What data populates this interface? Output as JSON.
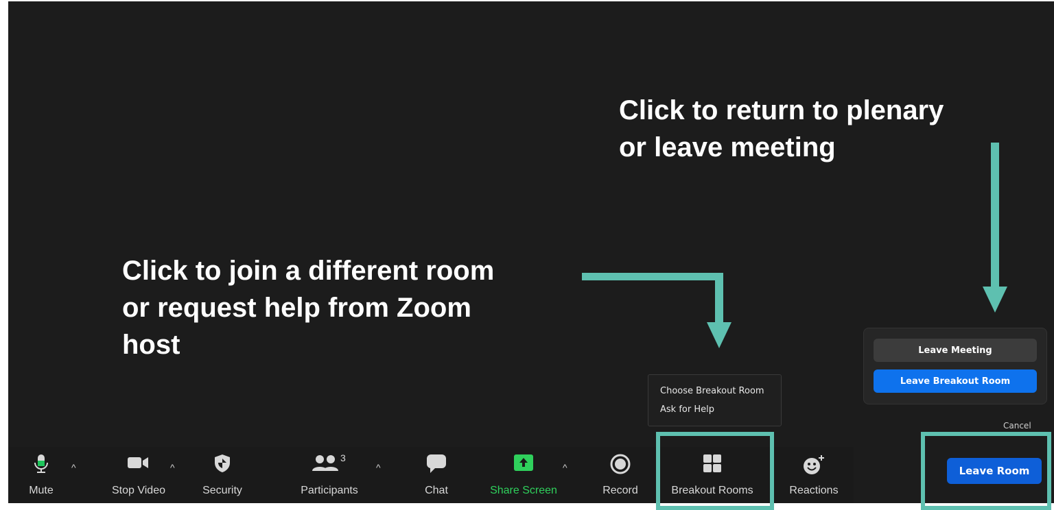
{
  "annotations": {
    "return": {
      "line1": "Click to return to plenary",
      "line2": "or leave meeting"
    },
    "join": {
      "line1": "Click to join a different room",
      "line2": "or request help from Zoom",
      "line3": "host"
    }
  },
  "breakout_menu": {
    "items": [
      "Choose Breakout Room",
      "Ask for Help"
    ]
  },
  "leave_panel": {
    "leave_meeting": "Leave Meeting",
    "leave_breakout": "Leave Breakout Room",
    "cancel": "Cancel"
  },
  "toolbar": {
    "mute": "Mute",
    "stop_video": "Stop Video",
    "security": "Security",
    "participants": "Participants",
    "participants_count": "3",
    "chat": "Chat",
    "share_screen": "Share Screen",
    "record": "Record",
    "breakout_rooms": "Breakout Rooms",
    "reactions": "Reactions",
    "caret": "^",
    "leave_room": "Leave Room"
  },
  "colors": {
    "accent_teal": "#5ec0b0",
    "leave_blue": "#0e5fd8",
    "share_green": "#2fd05c",
    "mic_green": "#1ec55b"
  }
}
